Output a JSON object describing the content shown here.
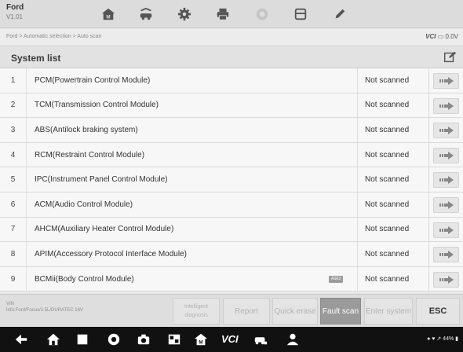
{
  "header": {
    "make": "Ford",
    "version": "V1.01"
  },
  "toolbar_icons": [
    "home-icon",
    "vehicle-swap-icon",
    "settings-icon",
    "print-icon",
    "help-icon",
    "save-icon",
    "edit-icon"
  ],
  "breadcrumb": "Ford > Automatic selection > Auto scan",
  "vci_label": "VCI",
  "vci_status": "0.0V",
  "list_title": "System list",
  "systems": [
    {
      "num": "1",
      "name": "PCM(Powertrain Control Module)",
      "status": "Not scanned"
    },
    {
      "num": "2",
      "name": "TCM(Transmission Control Module)",
      "status": "Not scanned"
    },
    {
      "num": "3",
      "name": "ABS(Antilock braking system)",
      "status": "Not scanned"
    },
    {
      "num": "4",
      "name": "RCM(Restraint Control Module)",
      "status": "Not scanned"
    },
    {
      "num": "5",
      "name": "IPC(Instrument Panel Control Module)",
      "status": "Not scanned"
    },
    {
      "num": "6",
      "name": "ACM(Audio Control Module)",
      "status": "Not scanned"
    },
    {
      "num": "7",
      "name": "AHCM(Auxiliary Heater Control Module)",
      "status": "Not scanned"
    },
    {
      "num": "8",
      "name": "APIM(Accessory Protocol Interface Module)",
      "status": "Not scanned"
    },
    {
      "num": "9",
      "name": "BCMii(Body Control Module)",
      "status": "Not scanned",
      "badge": "AS63"
    }
  ],
  "footer": {
    "vin_label": "VIN",
    "vehicle_info": "Info:Ford/Focus/1.5L/DURATEC 16V",
    "buttons": {
      "intelligent_diagnosis": "Intelligent diagnosis",
      "report": "Report",
      "quick_erase": "Quick erase",
      "fault_scan": "Fault scan",
      "enter_system": "Enter system",
      "esc": "ESC"
    }
  },
  "android_nav": {
    "vci_text": "VCI",
    "tray": "● ♥ ↗ 44% ▮"
  },
  "colors": {
    "active_button": "#9a9a9a",
    "row_background": "#f7f7f7",
    "nav_background": "#111111"
  }
}
